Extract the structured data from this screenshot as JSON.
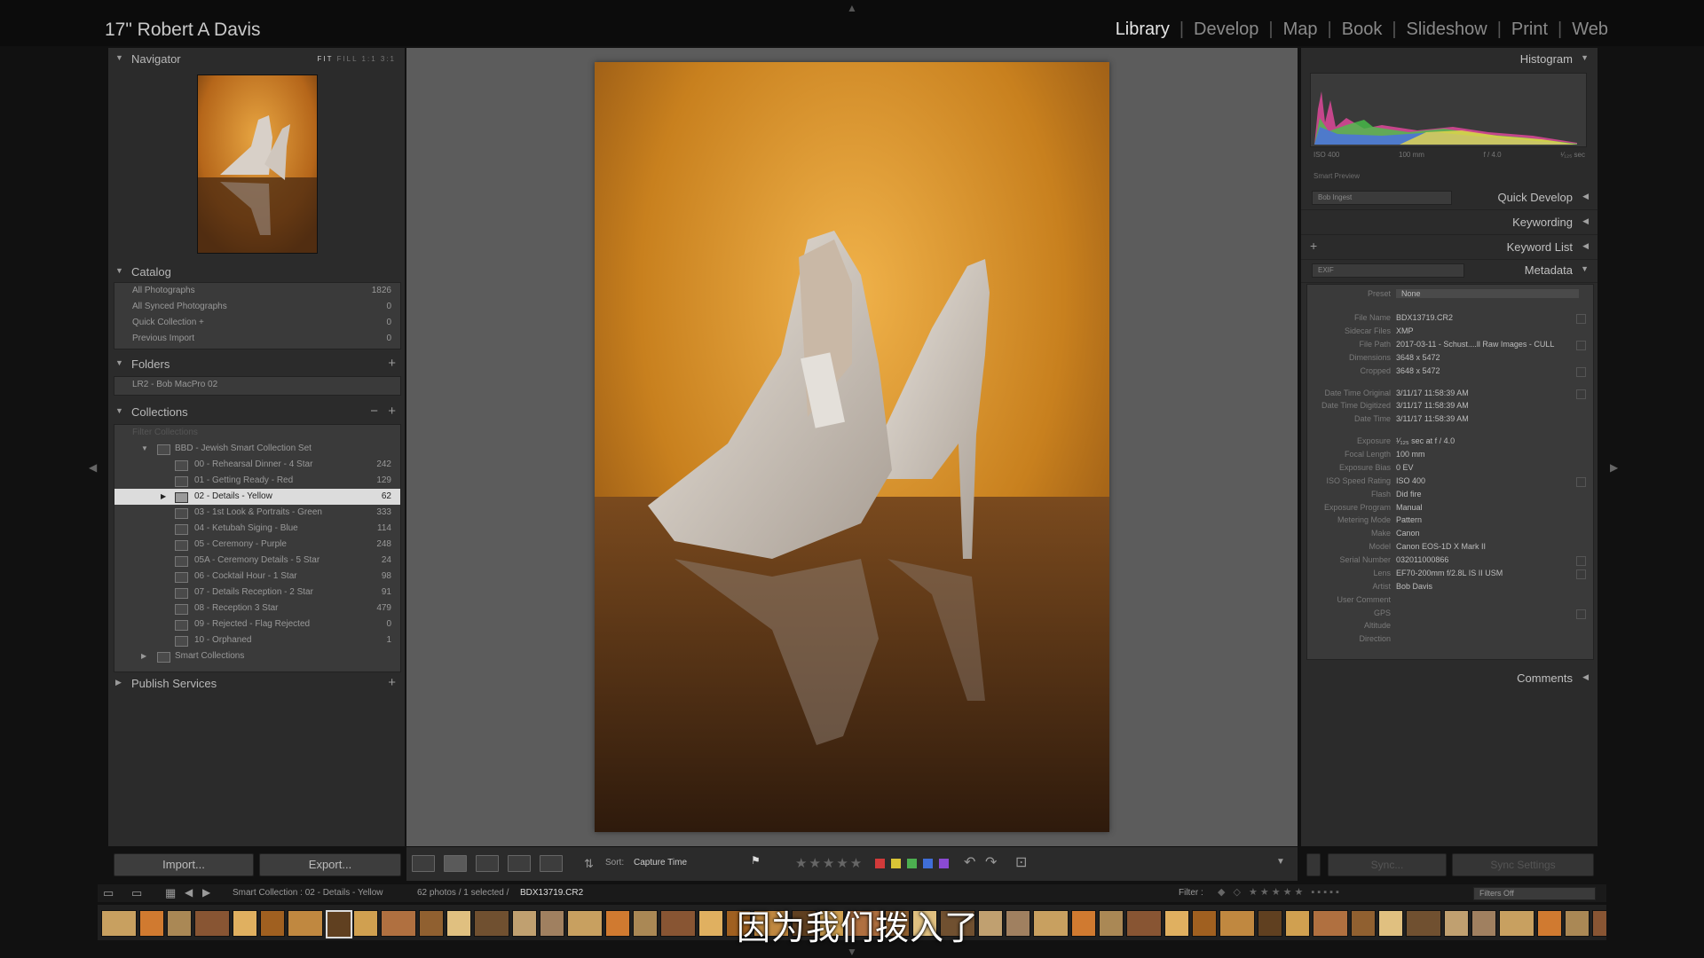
{
  "identity_plate": "17\" Robert A Davis",
  "modules": [
    "Library",
    "Develop",
    "Map",
    "Book",
    "Slideshow",
    "Print",
    "Web"
  ],
  "active_module": "Library",
  "left": {
    "navigator": {
      "title": "Navigator",
      "zoom": [
        "FIT",
        "FILL",
        "1:1",
        "3:1"
      ]
    },
    "catalog": {
      "title": "Catalog",
      "items": [
        {
          "label": "All Photographs",
          "count": "1826"
        },
        {
          "label": "All Synced Photographs",
          "count": "0"
        },
        {
          "label": "Quick Collection +",
          "count": "0"
        },
        {
          "label": "Previous Import",
          "count": "0"
        }
      ]
    },
    "folders": {
      "title": "Folders",
      "add": "+",
      "item": "LR2 - Bob MacPro 02"
    },
    "collections": {
      "title": "Collections",
      "minus": "−",
      "add": "+",
      "filter_placeholder": "Filter Collections",
      "set": "BBD - Jewish Smart Collection Set",
      "items": [
        {
          "label": "00 - Rehearsal Dinner - 4 Star",
          "count": "242"
        },
        {
          "label": "01 - Getting Ready - Red",
          "count": "129"
        },
        {
          "label": "02 - Details - Yellow",
          "count": "62"
        },
        {
          "label": "03 - 1st Look & Portraits - Green",
          "count": "333"
        },
        {
          "label": "04 - Ketubah Siging - Blue",
          "count": "114"
        },
        {
          "label": "05 - Ceremony - Purple",
          "count": "248"
        },
        {
          "label": "05A - Ceremony Details - 5 Star",
          "count": "24"
        },
        {
          "label": "06 - Cocktail Hour - 1 Star",
          "count": "98"
        },
        {
          "label": "07 - Details Reception - 2 Star",
          "count": "91"
        },
        {
          "label": "08 - Reception 3 Star",
          "count": "479"
        },
        {
          "label": "09 - Rejected - Flag Rejected",
          "count": "0"
        },
        {
          "label": "10 - Orphaned",
          "count": "1"
        }
      ],
      "smart": "Smart Collections"
    },
    "publish": {
      "title": "Publish Services",
      "add": "+"
    },
    "import_label": "Import...",
    "export_label": "Export..."
  },
  "toolbar": {
    "sort_label": "Sort:",
    "sort_value": "Capture Time"
  },
  "right": {
    "histogram": {
      "title": "Histogram",
      "iso": "ISO 400",
      "focal": "100 mm",
      "aperture": "f / 4.0",
      "shutter": "¹⁄₁₂₅ sec",
      "smart_preview": "Smart Preview"
    },
    "quick_develop": {
      "title": "Quick Develop",
      "preset": "Bob Ingest"
    },
    "keywording": {
      "title": "Keywording"
    },
    "keyword_list": {
      "title": "Keyword List",
      "add": "+"
    },
    "metadata": {
      "title": "Metadata",
      "set": "EXIF",
      "rows": [
        {
          "k": "Preset",
          "v": "None"
        },
        {
          "k": "File Name",
          "v": "BDX13719.CR2"
        },
        {
          "k": "Sidecar Files",
          "v": "XMP"
        },
        {
          "k": "File Path",
          "v": "2017-03-11 - Schust....ll Raw Images - CULL"
        },
        {
          "k": "Dimensions",
          "v": "3648 x 5472"
        },
        {
          "k": "Cropped",
          "v": "3648 x 5472"
        },
        {
          "k": "Date Time Original",
          "v": "3/11/17 11:58:39 AM"
        },
        {
          "k": "Date Time Digitized",
          "v": "3/11/17 11:58:39 AM"
        },
        {
          "k": "Date Time",
          "v": "3/11/17 11:58:39 AM"
        },
        {
          "k": "Exposure",
          "v": "¹⁄₁₂₅ sec at f / 4.0"
        },
        {
          "k": "Focal Length",
          "v": "100 mm"
        },
        {
          "k": "Exposure Bias",
          "v": "0 EV"
        },
        {
          "k": "ISO Speed Rating",
          "v": "ISO 400"
        },
        {
          "k": "Flash",
          "v": "Did fire"
        },
        {
          "k": "Exposure Program",
          "v": "Manual"
        },
        {
          "k": "Metering Mode",
          "v": "Pattern"
        },
        {
          "k": "Make",
          "v": "Canon"
        },
        {
          "k": "Model",
          "v": "Canon EOS-1D X Mark II"
        },
        {
          "k": "Serial Number",
          "v": "032011000866"
        },
        {
          "k": "Lens",
          "v": "EF70-200mm f/2.8L IS II USM"
        },
        {
          "k": "Artist",
          "v": "Bob Davis"
        },
        {
          "k": "User Comment",
          "v": ""
        },
        {
          "k": "GPS",
          "v": ""
        },
        {
          "k": "Altitude",
          "v": ""
        },
        {
          "k": "Direction",
          "v": ""
        }
      ]
    },
    "comments": {
      "title": "Comments"
    },
    "sync_label": "Sync...",
    "sync_settings_label": "Sync Settings"
  },
  "filmstrip": {
    "source": "Smart Collection : 02 - Details - Yellow",
    "status": "62 photos / 1 selected /",
    "file": "BDX13719.CR2",
    "filter_label": "Filter :",
    "filter_value": "Filters Off"
  },
  "subtitle": "因为我们拨入了",
  "colors": {
    "panel": "#2b2b2b",
    "center": "#5c5c5c",
    "photo_bg": "#c8801e"
  }
}
